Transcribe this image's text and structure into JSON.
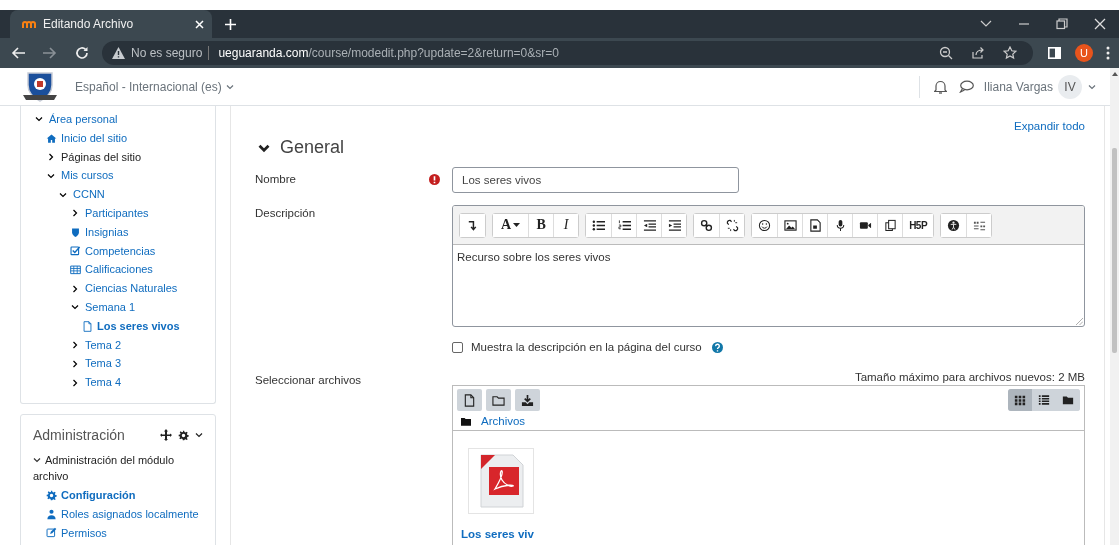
{
  "browser": {
    "tab_title": "Editando Archivo",
    "security_label": "No es seguro",
    "url_host": "ueguaranda.com",
    "url_path": "/course/modedit.php?update=2&return=0&sr=0",
    "profile_initial": "U"
  },
  "header": {
    "language": "Español - Internacional (es)",
    "user_name": "Iliana Vargas",
    "user_initials": "IV"
  },
  "navigation": {
    "items": [
      {
        "label": "Área personal",
        "kind": "branch",
        "expanded": true,
        "selected": false,
        "link": true,
        "children": [
          {
            "label": "Inicio del sitio",
            "kind": "home",
            "selected": false,
            "link": true
          },
          {
            "label": "Páginas del sitio",
            "kind": "branch",
            "expanded": false,
            "selected": false,
            "link": false
          },
          {
            "label": "Mis cursos",
            "kind": "branch",
            "expanded": true,
            "selected": false,
            "link": true,
            "children": [
              {
                "label": "CCNN",
                "kind": "branch",
                "expanded": true,
                "selected": false,
                "link": true,
                "children": [
                  {
                    "label": "Participantes",
                    "kind": "branch",
                    "expanded": false,
                    "selected": false,
                    "link": true
                  },
                  {
                    "label": "Insignias",
                    "kind": "shield",
                    "selected": false,
                    "link": true
                  },
                  {
                    "label": "Competencias",
                    "kind": "check",
                    "selected": false,
                    "link": true
                  },
                  {
                    "label": "Calificaciones",
                    "kind": "table",
                    "selected": false,
                    "link": true
                  },
                  {
                    "label": "Ciencias Naturales",
                    "kind": "branch",
                    "expanded": false,
                    "selected": false,
                    "link": true
                  },
                  {
                    "label": "Semana 1",
                    "kind": "branch",
                    "expanded": true,
                    "selected": false,
                    "link": true,
                    "children": [
                      {
                        "label": "Los seres vivos",
                        "kind": "file",
                        "selected": true,
                        "link": true
                      }
                    ]
                  },
                  {
                    "label": "Tema 2",
                    "kind": "branch",
                    "expanded": false,
                    "selected": false,
                    "link": true
                  },
                  {
                    "label": "Tema 3",
                    "kind": "branch",
                    "expanded": false,
                    "selected": false,
                    "link": true
                  },
                  {
                    "label": "Tema 4",
                    "kind": "branch",
                    "expanded": false,
                    "selected": false,
                    "link": true
                  }
                ]
              }
            ]
          }
        ]
      }
    ]
  },
  "administration": {
    "title": "Administración",
    "items": [
      {
        "label": "Administración del módulo archivo",
        "kind": "branch",
        "expanded": true,
        "selected": false,
        "link": false,
        "children": [
          {
            "label": "Configuración",
            "kind": "gear",
            "selected": true,
            "link": true
          },
          {
            "label": "Roles asignados localmente",
            "kind": "roles",
            "selected": false,
            "link": true
          },
          {
            "label": "Permisos",
            "kind": "edit",
            "selected": false,
            "link": true
          }
        ]
      }
    ]
  },
  "form": {
    "expand_all": "Expandir todo",
    "section": {
      "title": "General",
      "expanded": true
    },
    "name_label": "Nombre",
    "name_value": "Los seres vivos",
    "description_label": "Descripción",
    "description_value": "Recurso sobre los seres vivos",
    "toolbar_groups": [
      [
        {
          "kind": "collapse"
        }
      ],
      [
        {
          "kind": "font",
          "label": "A"
        },
        {
          "kind": "bold",
          "label": "B"
        },
        {
          "kind": "italic",
          "label": "I"
        }
      ],
      [
        {
          "kind": "ul"
        },
        {
          "kind": "ol"
        },
        {
          "kind": "outdent"
        },
        {
          "kind": "indent"
        }
      ],
      [
        {
          "kind": "link"
        },
        {
          "kind": "unlink"
        }
      ],
      [
        {
          "kind": "emoji"
        },
        {
          "kind": "image"
        },
        {
          "kind": "media"
        },
        {
          "kind": "audio"
        },
        {
          "kind": "video"
        },
        {
          "kind": "copy"
        },
        {
          "kind": "h5p",
          "label": "H5P"
        }
      ],
      [
        {
          "kind": "accessibility"
        },
        {
          "kind": "screenreader"
        }
      ]
    ],
    "show_description": {
      "label": "Muestra la descripción en la página del curso",
      "checked": false
    },
    "files_label": "Seleccionar archivos",
    "max_size": "Tamaño máximo para archivos nuevos: 2 MB",
    "filepicker": {
      "actions": [
        {
          "kind": "file"
        },
        {
          "kind": "folder"
        },
        {
          "kind": "download"
        }
      ],
      "views": [
        {
          "kind": "grid",
          "selected": true
        },
        {
          "kind": "list",
          "selected": false
        },
        {
          "kind": "tree",
          "selected": false
        }
      ],
      "path": "Archivos",
      "files": [
        {
          "kind": "pdf",
          "name": "Los seres viv"
        }
      ]
    }
  }
}
